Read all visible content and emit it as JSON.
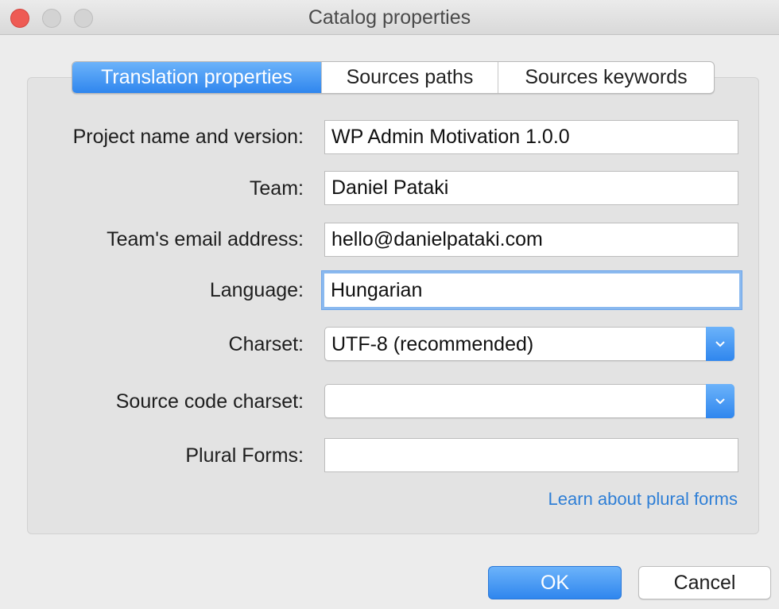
{
  "window": {
    "title": "Catalog properties"
  },
  "tabs": [
    {
      "label": "Translation properties",
      "active": true
    },
    {
      "label": "Sources paths",
      "active": false
    },
    {
      "label": "Sources keywords",
      "active": false
    }
  ],
  "form": {
    "project": {
      "label": "Project name and version:",
      "value": "WP Admin Motivation 1.0.0"
    },
    "team": {
      "label": "Team:",
      "value": "Daniel Pataki"
    },
    "email": {
      "label": "Team's email address:",
      "value": "hello@danielpataki.com"
    },
    "language": {
      "label": "Language:",
      "value": "Hungarian"
    },
    "charset": {
      "label": "Charset:",
      "value": "UTF-8 (recommended)"
    },
    "source_charset": {
      "label": "Source code charset:",
      "value": ""
    },
    "plural_forms": {
      "label": "Plural Forms:",
      "value": ""
    },
    "plural_link": "Learn about plural forms"
  },
  "buttons": {
    "ok": "OK",
    "cancel": "Cancel"
  },
  "colors": {
    "accent": "#2f86ee",
    "link": "#2f7fd6",
    "close": "#ee5b54"
  },
  "icons": {
    "dropdown": "chevron-down-icon"
  }
}
